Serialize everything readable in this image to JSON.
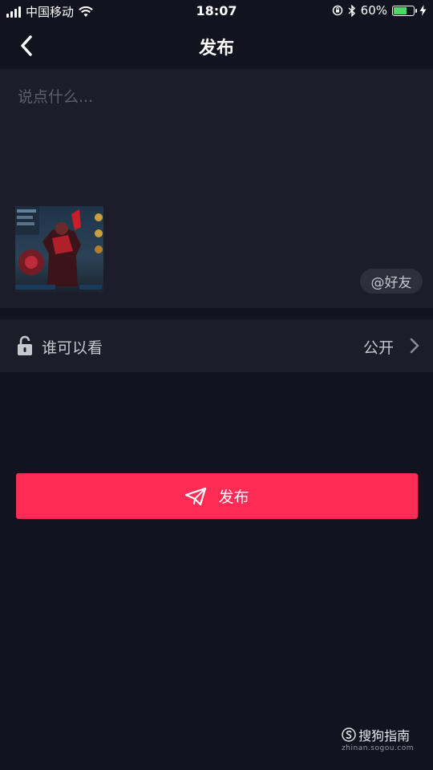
{
  "status_bar": {
    "carrier": "中国移动",
    "time": "18:07",
    "battery_text": "60%",
    "battery_level": 0.6
  },
  "nav": {
    "back_icon": "chevron-left-icon",
    "title": "发布"
  },
  "caption": {
    "placeholder": "说点什么...",
    "value": ""
  },
  "mention": {
    "label": "@好友"
  },
  "privacy": {
    "icon": "unlock-icon",
    "label": "谁可以看",
    "value": "公开"
  },
  "publish": {
    "icon": "paper-plane-icon",
    "label": "发布"
  },
  "watermark": {
    "brand": "搜狗指南",
    "url": "zhinan.sogou.com"
  },
  "colors": {
    "background": "#12131e",
    "panel": "#1c1d28",
    "accent": "#fe2c55",
    "battery": "#4cd964"
  }
}
